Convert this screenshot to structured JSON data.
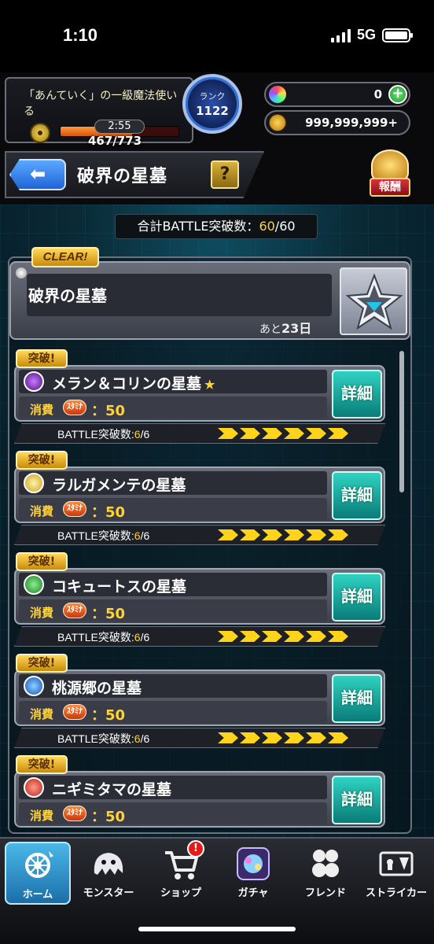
{
  "status_bar": {
    "time": "1:10",
    "network": "5G"
  },
  "header": {
    "player_title": "「あんていく」の一級魔法使いる",
    "stamina_timer": "2:55",
    "stamina": "467/773",
    "stamina_fraction": 0.604,
    "rank_label": "ランク",
    "rank_value": "1122",
    "orbs": "0",
    "coins": "999,999,999+"
  },
  "title_bar": {
    "back_icon": "back-arrow-icon",
    "title": "破界の星墓",
    "help_label": "?",
    "reward_label": "報酬"
  },
  "total_battle": {
    "prefix": "合計BATTLE突破数：",
    "current": "60",
    "suffix": "/60"
  },
  "quest_header": {
    "clear_tag": "CLEAR!",
    "title": "破界の星墓",
    "remaining_prefix": "あと",
    "remaining_value": "23日"
  },
  "cards": [
    {
      "tag": "突破!",
      "element": "dark",
      "title": "メラン＆コリンの星墓",
      "star": "★",
      "cost_label": "消費",
      "stamina_label": "ｽﾀﾐﾅ",
      "cost": "：50",
      "detail": "詳細",
      "battle_prefix": "BATTLE突破数:",
      "battle_current": "6",
      "battle_total": "/6"
    },
    {
      "tag": "突破!",
      "element": "light",
      "title": "ラルガメンテの星墓",
      "star": "",
      "cost_label": "消費",
      "stamina_label": "ｽﾀﾐﾅ",
      "cost": "：50",
      "detail": "詳細",
      "battle_prefix": "BATTLE突破数:",
      "battle_current": "6",
      "battle_total": "/6"
    },
    {
      "tag": "突破!",
      "element": "wood",
      "title": "コキュートスの星墓",
      "star": "",
      "cost_label": "消費",
      "stamina_label": "ｽﾀﾐﾅ",
      "cost": "：50",
      "detail": "詳細",
      "battle_prefix": "BATTLE突破数:",
      "battle_current": "6",
      "battle_total": "/6"
    },
    {
      "tag": "突破!",
      "element": "water",
      "title": "桃源郷の星墓",
      "star": "",
      "cost_label": "消費",
      "stamina_label": "ｽﾀﾐﾅ",
      "cost": "：50",
      "detail": "詳細",
      "battle_prefix": "BATTLE突破数:",
      "battle_current": "6",
      "battle_total": "/6"
    },
    {
      "tag": "突破!",
      "element": "fire",
      "title": "ニギミタマの星墓",
      "star": "",
      "cost_label": "消費",
      "stamina_label": "ｽﾀﾐﾅ",
      "cost": "：50",
      "detail": "詳細",
      "battle_prefix": "",
      "battle_current": "",
      "battle_total": ""
    }
  ],
  "nav": [
    {
      "label": "ホーム",
      "icon": "home-icon",
      "active": true
    },
    {
      "label": "モンスター",
      "icon": "monster-icon",
      "active": false
    },
    {
      "label": "ショップ",
      "icon": "cart-icon",
      "active": false,
      "badge": "!"
    },
    {
      "label": "ガチャ",
      "icon": "gacha-icon",
      "active": false
    },
    {
      "label": "フレンド",
      "icon": "friend-icon",
      "active": false
    },
    {
      "label": "ストライカー",
      "icon": "striker-icon",
      "active": false
    }
  ],
  "colors": {
    "accent_gold": "#ffd23a",
    "detail_teal": "#1fa9a0",
    "home_blue": "#2b8fd0",
    "stage_bg": "#0a2a36"
  }
}
